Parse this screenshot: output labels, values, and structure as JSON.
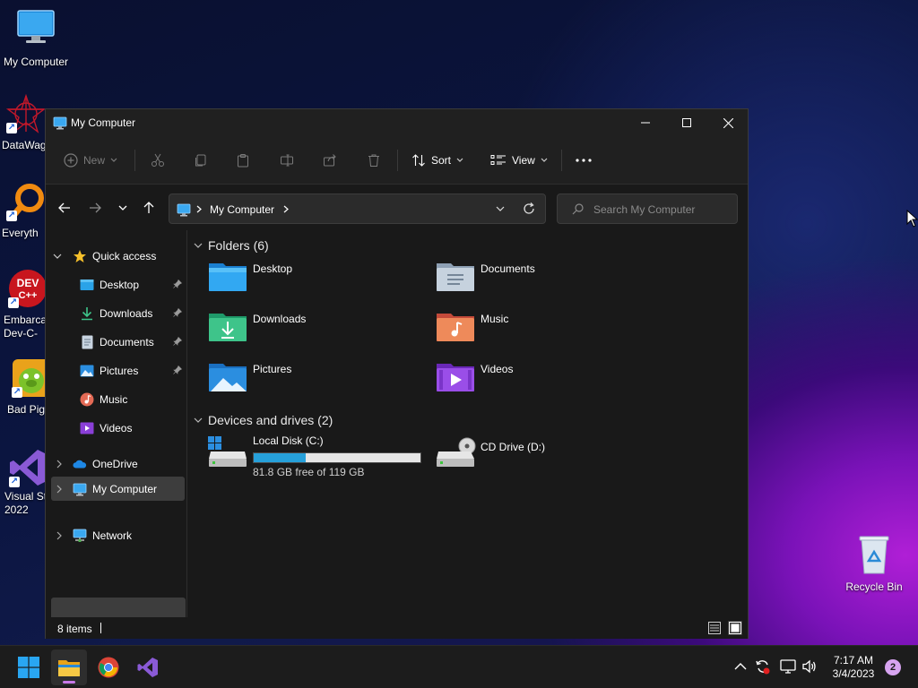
{
  "desktop": {
    "icons": [
      {
        "label": "My Computer"
      },
      {
        "label": "DataWag"
      },
      {
        "label": "Everyth"
      },
      {
        "label": "Embarca\nDev-C-"
      },
      {
        "label": "Bad Pig"
      },
      {
        "label": "Visual St\n2022"
      },
      {
        "label": "Recycle Bin"
      }
    ]
  },
  "window": {
    "title": "My Computer",
    "toolbar": {
      "new_label": "New",
      "sort_label": "Sort",
      "view_label": "View"
    },
    "address": {
      "crumb": "My Computer"
    },
    "search": {
      "placeholder": "Search My Computer"
    },
    "sidebar": {
      "quick_access": "Quick access",
      "items": [
        {
          "label": "Desktop",
          "pinned": true,
          "icon": "desktop-icon"
        },
        {
          "label": "Downloads",
          "pinned": true,
          "icon": "download-icon"
        },
        {
          "label": "Documents",
          "pinned": true,
          "icon": "document-icon"
        },
        {
          "label": "Pictures",
          "pinned": true,
          "icon": "picture-icon"
        },
        {
          "label": "Music",
          "pinned": false,
          "icon": "music-icon"
        },
        {
          "label": "Videos",
          "pinned": false,
          "icon": "video-icon"
        }
      ],
      "onedrive": "OneDrive",
      "my_computer": "My Computer",
      "network": "Network"
    },
    "folders": {
      "header": "Folders (6)",
      "items": [
        {
          "name": "Desktop"
        },
        {
          "name": "Documents"
        },
        {
          "name": "Downloads"
        },
        {
          "name": "Music"
        },
        {
          "name": "Pictures"
        },
        {
          "name": "Videos"
        }
      ]
    },
    "drives": {
      "header": "Devices and drives (2)",
      "items": [
        {
          "name": "Local Disk (C:)",
          "free_text": "81.8 GB free of 119 GB",
          "used_fraction": 0.31
        },
        {
          "name": "CD Drive (D:)"
        }
      ]
    },
    "status": {
      "count": "8 items"
    }
  },
  "taskbar": {
    "time": "7:17 AM",
    "date": "3/4/2023",
    "notifications": "2"
  },
  "colors": {
    "accent": "#26a0da",
    "window_bg": "#191919",
    "titlebar_bg": "#202020",
    "taskbar_bg": "#1c1c1c"
  }
}
